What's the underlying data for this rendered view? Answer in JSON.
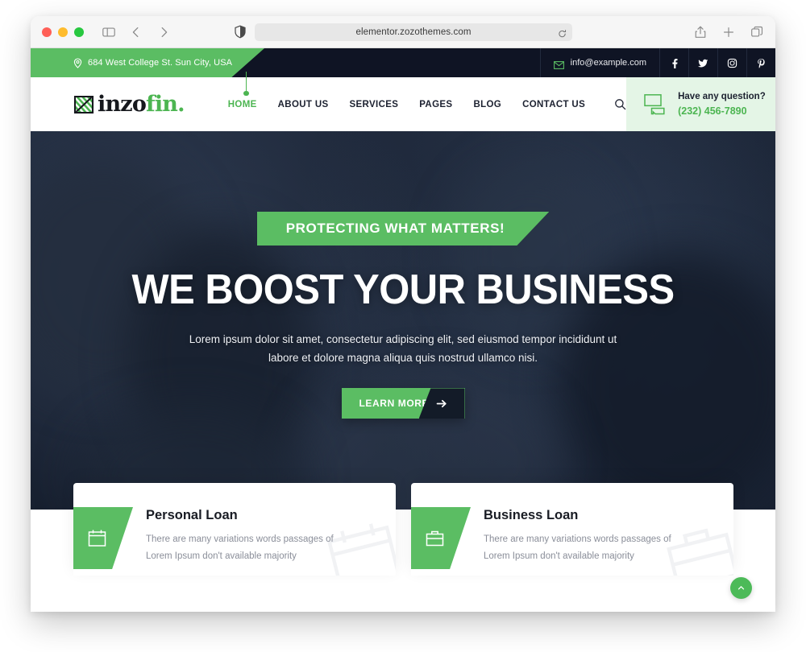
{
  "browser": {
    "url": "elementor.zozothemes.com",
    "icons": {
      "sidebar": "sidebar-icon",
      "back": "back-chevron-icon",
      "forward": "forward-chevron-icon",
      "shield": "shield-privacy-icon",
      "reload": "reload-icon",
      "share": "share-icon",
      "new_tab": "plus-icon",
      "tabs": "tabs-overview-icon"
    }
  },
  "topbar": {
    "address": "684 West College St. Sun City, USA",
    "email": "info@example.com",
    "socials": [
      {
        "name": "facebook",
        "glyph": "f"
      },
      {
        "name": "twitter",
        "glyph": "t"
      },
      {
        "name": "instagram",
        "glyph": "i"
      },
      {
        "name": "pinterest",
        "glyph": "p"
      }
    ]
  },
  "header": {
    "logo": {
      "part1": "inzo",
      "part2": "fin",
      "dot": "."
    },
    "nav": [
      {
        "label": "HOME",
        "active": true
      },
      {
        "label": "ABOUT US",
        "active": false
      },
      {
        "label": "SERVICES",
        "active": false
      },
      {
        "label": "PAGES",
        "active": false
      },
      {
        "label": "BLOG",
        "active": false
      },
      {
        "label": "CONTACT US",
        "active": false
      }
    ],
    "question_title": "Have any question?",
    "question_phone": "(232) 456-7890"
  },
  "hero": {
    "badge": "PROTECTING WHAT MATTERS!",
    "heading": "WE BOOST YOUR BUSINESS",
    "paragraph": "Lorem ipsum dolor sit amet, consectetur adipiscing elit, sed eiusmod tempor incididunt ut labore et dolore magna aliqua quis nostrud ullamco nisi.",
    "cta_label": "LEARN MORE"
  },
  "cards": [
    {
      "icon": "calendar-icon",
      "title": "Personal Loan",
      "line1": "There are many variations words passages of",
      "line2": "Lorem Ipsum don't available majority"
    },
    {
      "icon": "briefcase-icon",
      "title": "Business Loan",
      "line1": "There are many variations words passages of",
      "line2": "Lorem Ipsum don't available majority"
    }
  ],
  "colors": {
    "brand_green": "#5bbd63",
    "dark_navy": "#0f1424",
    "light_green_panel": "#e4f5e6"
  }
}
